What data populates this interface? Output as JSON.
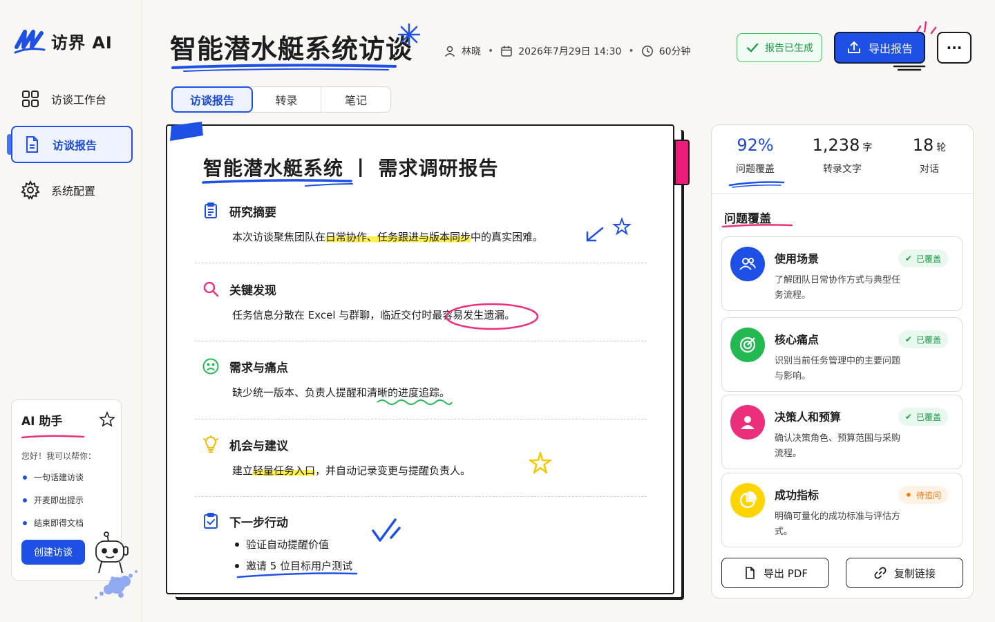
{
  "app": {
    "name": "访界 AI"
  },
  "sidebar": {
    "items": [
      {
        "label": "访谈工作台",
        "icon": "grid-icon"
      },
      {
        "label": "访谈报告",
        "icon": "document-icon"
      },
      {
        "label": "系统配置",
        "icon": "gear-icon"
      }
    ],
    "assistant": {
      "title": "AI 助手",
      "greeting": "您好！我可以帮你：",
      "features": [
        "一句话建访谈",
        "开麦即出提示",
        "结束即得文档"
      ],
      "create_label": "创建访谈"
    }
  },
  "header": {
    "title": "智能潜水艇系统访谈",
    "interviewer": "林晓",
    "datetime": "2026年7月29日 14:30",
    "duration": "60分钟",
    "status_label": "报告已生成",
    "export_label": "导出报告",
    "more_label": "···"
  },
  "tabs": [
    "访谈报告",
    "转录",
    "笔记"
  ],
  "report": {
    "title": "智能潜水艇系统 丨 需求调研报告",
    "sections": [
      {
        "heading": "研究摘要",
        "pre": "本次访谈聚焦团队在",
        "hl": "日常协作、任务跟进与版本同步",
        "post": "中的真实困难。"
      },
      {
        "heading": "关键发现",
        "pre": "任务信息分散在 Excel 与群聊，临近交付时",
        "hl": "最容易发生遗漏。",
        "post": ""
      },
      {
        "heading": "需求与痛点",
        "pre": "缺少统一版本、负责人提醒和",
        "hl": "清晰的进度追踪",
        "post": "。"
      },
      {
        "heading": "机会与建议",
        "pre": "建立",
        "hl": "轻量任务入口",
        "post": "，并自动记录变更与提醒负责人。"
      },
      {
        "heading": "下一步行动",
        "bullets": [
          "验证自动提醒价值",
          "邀请 5 位目标用户测试"
        ]
      }
    ]
  },
  "stats": [
    {
      "value": "92%",
      "unit": "",
      "label": "问题覆盖"
    },
    {
      "value": "1,238",
      "unit": "字",
      "label": "转录文字"
    },
    {
      "value": "18",
      "unit": "轮",
      "label": "对话"
    }
  ],
  "coverage": {
    "title": "问题覆盖",
    "items": [
      {
        "name": "使用场景",
        "desc": "了解团队日常协作方式与典型任务流程。",
        "status": "已覆盖",
        "color": "#1e50e6"
      },
      {
        "name": "核心痛点",
        "desc": "识别当前任务管理中的主要问题与影响。",
        "status": "已覆盖",
        "color": "#22b852"
      },
      {
        "name": "决策人和预算",
        "desc": "确认决策角色、预算范围与采购流程。",
        "status": "已覆盖",
        "color": "#ec2f7a"
      },
      {
        "name": "成功指标",
        "desc": "明确可量化的成功标准与评估方式。",
        "status": "待追问",
        "color": "#ffd400"
      }
    ],
    "export_pdf_label": "导出 PDF",
    "copy_link_label": "复制链接"
  }
}
